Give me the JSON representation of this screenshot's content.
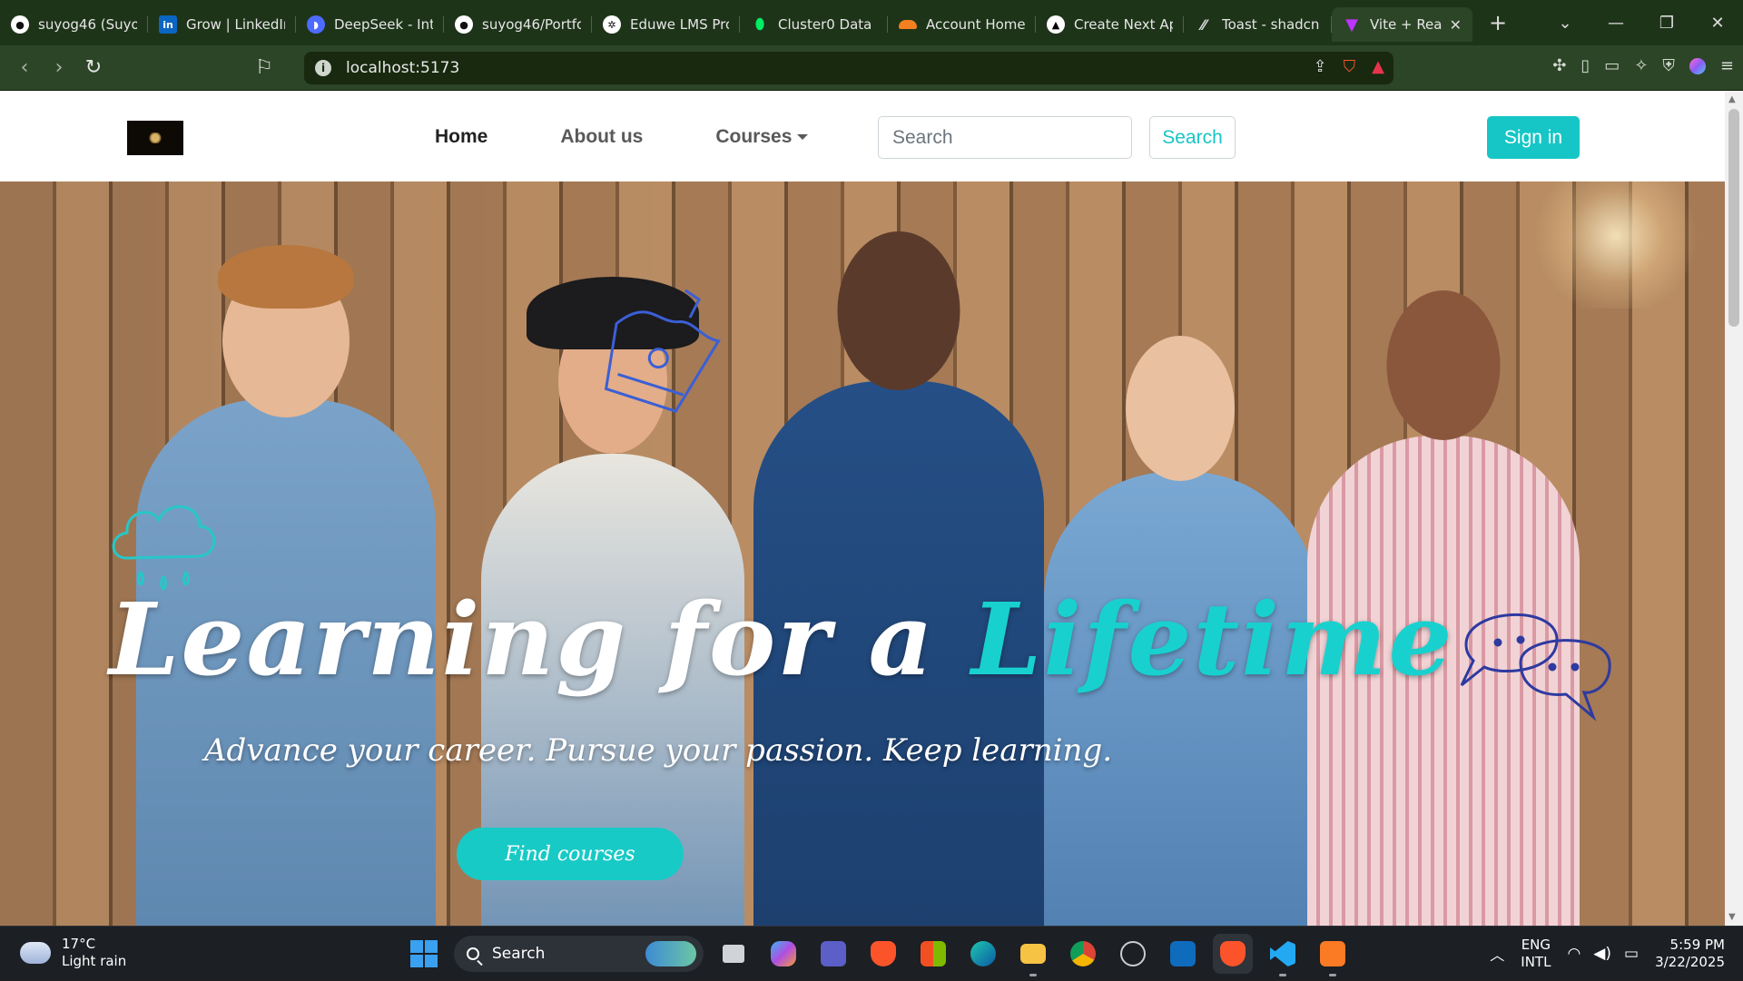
{
  "browser": {
    "tabs": [
      {
        "label": "suyog46 (Suyog",
        "icon": "github-icon",
        "color": "#ffffff"
      },
      {
        "label": "Grow | LinkedIn",
        "icon": "linkedin-icon",
        "color": "#0a66c2"
      },
      {
        "label": "DeepSeek - Int",
        "icon": "deepseek-icon",
        "color": "#4d6bfe"
      },
      {
        "label": "suyog46/Portfo",
        "icon": "github-icon",
        "color": "#ffffff"
      },
      {
        "label": "Eduwe LMS Pro",
        "icon": "openai-icon",
        "color": "#ffffff"
      },
      {
        "label": "Cluster0 Data |",
        "icon": "mongodb-leaf-icon",
        "color": "#00ed64"
      },
      {
        "label": "Account Home",
        "icon": "cloudflare-icon",
        "color": "#f38020"
      },
      {
        "label": "Create Next Ap",
        "icon": "vercel-icon",
        "color": "#ffffff"
      },
      {
        "label": "Toast - shadcn",
        "icon": "shadcn-icon",
        "color": "#ffffff"
      },
      {
        "label": "Vite + Rea",
        "icon": "vite-icon",
        "color": "#bd34fe",
        "active": true
      }
    ],
    "address": "localhost:5173"
  },
  "site": {
    "nav": {
      "links": [
        "Home",
        "About us",
        "Courses"
      ],
      "search_placeholder": "Search",
      "search_button": "Search",
      "signin": "Sign in"
    },
    "hero": {
      "title_main": "Learning for a",
      "title_accent": "Lifetime",
      "subtitle": "Advance your career. Pursue your passion. Keep learning.",
      "cta": "Find courses"
    },
    "colors": {
      "accent": "#16c6c6"
    }
  },
  "taskbar": {
    "weather": {
      "temp": "17°C",
      "desc": "Light rain"
    },
    "search": "Search",
    "lang": [
      "ENG",
      "INTL"
    ],
    "time": "5:59 PM",
    "date": "3/22/2025"
  }
}
